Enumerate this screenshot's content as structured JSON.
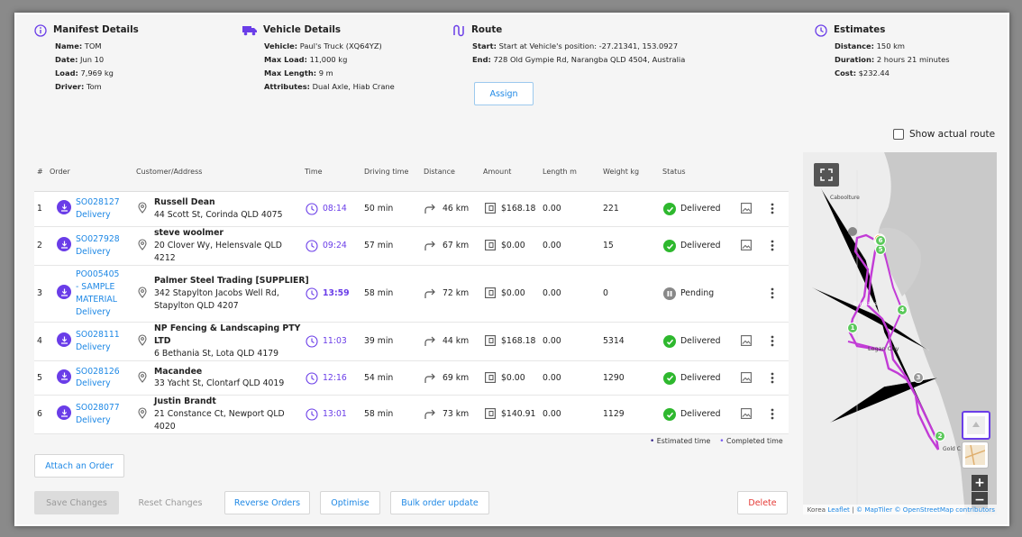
{
  "manifest": {
    "title": "Manifest Details",
    "rows": [
      {
        "label": "Name:",
        "value": "TOM"
      },
      {
        "label": "Date:",
        "value": "Jun 10"
      },
      {
        "label": "Load:",
        "value": "7,969  kg"
      },
      {
        "label": "Driver:",
        "value": "Tom"
      }
    ]
  },
  "vehicle": {
    "title": "Vehicle Details",
    "rows": [
      {
        "label": "Vehicle:",
        "value": "Paul's Truck (XQ64YZ)"
      },
      {
        "label": "Max Load:",
        "value": "11,000  kg"
      },
      {
        "label": "Max Length:",
        "value": "9 m"
      },
      {
        "label": "Attributes:",
        "value": "Dual Axle, Hiab Crane"
      }
    ]
  },
  "route": {
    "title": "Route",
    "rows": [
      {
        "label": "Start:",
        "value": "Start at Vehicle's position: -27.21341, 153.0927"
      },
      {
        "label": "End:",
        "value": "728 Old Gympie Rd, Narangba QLD 4504, Australia"
      }
    ],
    "assign_label": "Assign"
  },
  "estimates": {
    "title": "Estimates",
    "rows": [
      {
        "label": "Distance:",
        "value": "150 km"
      },
      {
        "label": "Duration:",
        "value": "2 hours 21 minutes"
      },
      {
        "label": "Cost:",
        "value": "$232.44"
      }
    ]
  },
  "show_actual_route": "Show actual route",
  "table": {
    "headers": [
      "#",
      "Order",
      "Customer/Address",
      "Time",
      "Driving time",
      "Distance",
      "Amount",
      "Length m",
      "Weight kg",
      "Status"
    ],
    "rows": [
      {
        "num": "1",
        "order": [
          "SO028127",
          "Delivery"
        ],
        "customer": "Russell Dean",
        "address": [
          "44 Scott St, Corinda QLD 4075"
        ],
        "time": "08:14",
        "driving": "50 min",
        "distance": "46 km",
        "amount": "$168.18",
        "length": "0.00",
        "weight": "221",
        "status": "Delivered"
      },
      {
        "num": "2",
        "order": [
          "SO027928",
          "Delivery"
        ],
        "customer": "steve woolmer",
        "address": [
          "20 Clover Wy, Helensvale QLD",
          "4212"
        ],
        "time": "09:24",
        "driving": "57 min",
        "distance": "67 km",
        "amount": "$0.00",
        "length": "0.00",
        "weight": "15",
        "status": "Delivered"
      },
      {
        "num": "3",
        "order": [
          "PO005405",
          "- SAMPLE",
          "MATERIAL",
          "Delivery"
        ],
        "customer": "Palmer Steel Trading [SUPPLIER]",
        "address": [
          "342 Stapylton Jacobs Well Rd,",
          "Stapylton QLD 4207"
        ],
        "time": "13:59",
        "driving": "58 min",
        "distance": "72 km",
        "amount": "$0.00",
        "length": "0.00",
        "weight": "0",
        "status": "Pending"
      },
      {
        "num": "4",
        "order": [
          "SO028111",
          "Delivery"
        ],
        "customer": "NP Fencing & Landscaping PTY LTD",
        "address": [
          "6 Bethania St, Lota QLD 4179"
        ],
        "time": "11:03",
        "driving": "39 min",
        "distance": "44 km",
        "amount": "$168.18",
        "length": "0.00",
        "weight": "5314",
        "status": "Delivered"
      },
      {
        "num": "5",
        "order": [
          "SO028126",
          "Delivery"
        ],
        "customer": "Macandee",
        "address": [
          "33 Yacht St, Clontarf QLD 4019"
        ],
        "time": "12:16",
        "driving": "54 min",
        "distance": "69 km",
        "amount": "$0.00",
        "length": "0.00",
        "weight": "1290",
        "status": "Delivered"
      },
      {
        "num": "6",
        "order": [
          "SO028077",
          "Delivery"
        ],
        "customer": "Justin Brandt",
        "address": [
          "21 Constance Ct, Newport QLD",
          "4020"
        ],
        "time": "13:01",
        "driving": "58 min",
        "distance": "73 km",
        "amount": "$140.91",
        "length": "0.00",
        "weight": "1129",
        "status": "Delivered"
      }
    ]
  },
  "legend": {
    "estimated": "Estimated time",
    "completed": "Completed time"
  },
  "buttons": {
    "attach": "Attach an Order",
    "save": "Save Changes",
    "reset": "Reset Changes",
    "reverse": "Reverse Orders",
    "optimise": "Optimise",
    "bulk": "Bulk order update",
    "delete": "Delete"
  },
  "map": {
    "place_labels": [
      "Caboolture",
      "Brisbane",
      "Logan City",
      "Gold C"
    ],
    "markers": [
      "1",
      "2",
      "3",
      "4",
      "5",
      "6"
    ],
    "attribution_left": "Korea",
    "attribution_links": [
      "Leaflet",
      "© MapTiler",
      "© OpenStreetMap contributors"
    ]
  },
  "colors": {
    "accent": "#6a3de8",
    "link": "#1e88e5",
    "delivered": "#2eb82e",
    "pending": "#888888",
    "delete": "#e53935",
    "route": "#c23bd6"
  }
}
